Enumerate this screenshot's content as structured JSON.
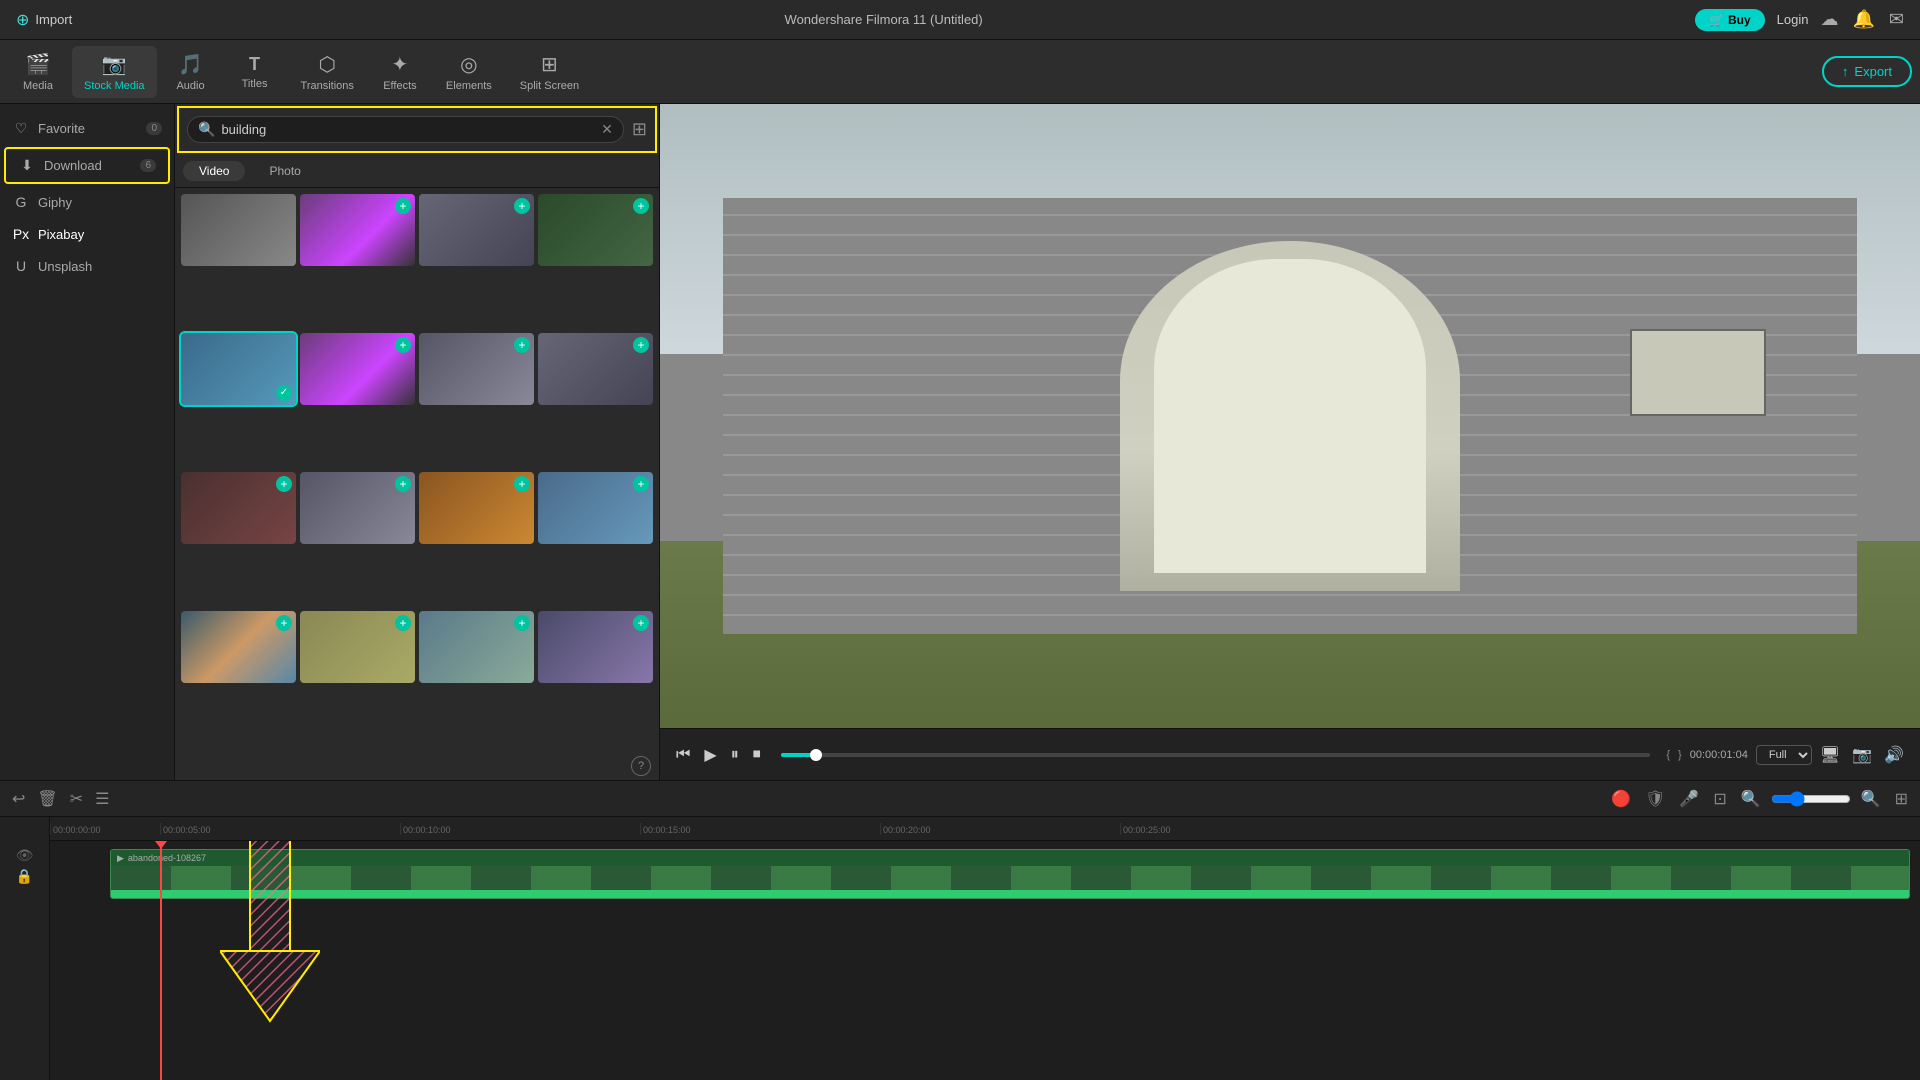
{
  "app": {
    "title": "Wondershare Filmora 11 (Untitled)",
    "import_label": "Import",
    "buy_label": "Buy",
    "login_label": "Login",
    "export_label": "Export"
  },
  "toolbar": {
    "items": [
      {
        "id": "media",
        "label": "Media",
        "icon": "🎬"
      },
      {
        "id": "stock-media",
        "label": "Stock Media",
        "icon": "📷",
        "active": true
      },
      {
        "id": "audio",
        "label": "Audio",
        "icon": "🎵"
      },
      {
        "id": "titles",
        "label": "Titles",
        "icon": "T"
      },
      {
        "id": "transitions",
        "label": "Transitions",
        "icon": "⟶"
      },
      {
        "id": "effects",
        "label": "Effects",
        "icon": "✨"
      },
      {
        "id": "elements",
        "label": "Elements",
        "icon": "◎"
      },
      {
        "id": "split-screen",
        "label": "Split Screen",
        "icon": "⊞"
      }
    ]
  },
  "sidebar": {
    "items": [
      {
        "id": "favorite",
        "label": "Favorite",
        "icon": "♡",
        "count": "0"
      },
      {
        "id": "download",
        "label": "Download",
        "icon": "⬇",
        "count": "6"
      },
      {
        "id": "giphy",
        "label": "Giphy",
        "icon": "G"
      },
      {
        "id": "pixabay",
        "label": "Pixabay",
        "icon": "Px",
        "active": true
      },
      {
        "id": "unsplash",
        "label": "Unsplash",
        "icon": "U"
      }
    ]
  },
  "search": {
    "query": "building",
    "placeholder": "Search...",
    "video_tab": "Video",
    "photo_tab": "Photo"
  },
  "media_grid": {
    "thumbs": [
      {
        "id": 1,
        "color": "thumb-color-1",
        "selected": false,
        "has_plus": false,
        "has_check": false
      },
      {
        "id": 2,
        "color": "thumb-color-2",
        "selected": false,
        "has_plus": true,
        "has_check": false
      },
      {
        "id": 3,
        "color": "thumb-color-3",
        "selected": false,
        "has_plus": true,
        "has_check": false
      },
      {
        "id": 4,
        "color": "thumb-color-4",
        "selected": false,
        "has_plus": true,
        "has_check": false
      },
      {
        "id": 5,
        "color": "thumb-color-5",
        "selected": true,
        "has_plus": false,
        "has_check": true
      },
      {
        "id": 6,
        "color": "thumb-color-2",
        "selected": false,
        "has_plus": true,
        "has_check": false
      },
      {
        "id": 7,
        "color": "thumb-color-7",
        "selected": false,
        "has_plus": true,
        "has_check": false
      },
      {
        "id": 8,
        "color": "thumb-color-3",
        "selected": false,
        "has_plus": true,
        "has_check": false
      },
      {
        "id": 9,
        "color": "thumb-color-6",
        "selected": false,
        "has_plus": true,
        "has_check": false
      },
      {
        "id": 10,
        "color": "thumb-color-7",
        "selected": false,
        "has_plus": true,
        "has_check": false
      },
      {
        "id": 11,
        "color": "thumb-color-8",
        "selected": false,
        "has_plus": true,
        "has_check": false
      },
      {
        "id": 12,
        "color": "thumb-color-9",
        "selected": false,
        "has_plus": true,
        "has_check": false
      },
      {
        "id": 13,
        "color": "thumb-color-13",
        "selected": false,
        "has_plus": true,
        "has_check": false
      },
      {
        "id": 14,
        "color": "thumb-color-14",
        "selected": false,
        "has_plus": true,
        "has_check": false
      },
      {
        "id": 15,
        "color": "thumb-color-15",
        "selected": false,
        "has_plus": true,
        "has_check": false
      },
      {
        "id": 16,
        "color": "thumb-color-16",
        "selected": false,
        "has_plus": true,
        "has_check": false
      }
    ]
  },
  "preview": {
    "time_current": "00:00:01:04",
    "time_total": "00:00:01:04",
    "quality": "Full",
    "progress_percent": 4
  },
  "timeline": {
    "marks": [
      "00:00:00:00",
      "00:00:05:00",
      "00:00:10:00",
      "00:00:15:00",
      "00:00:20:00",
      "00:00:25:00"
    ],
    "clip_label": "abandoned-108267",
    "playhead_time": "00:00:00:00"
  },
  "annotations": {
    "download_label": "Download",
    "sidebar_highlight": true
  }
}
